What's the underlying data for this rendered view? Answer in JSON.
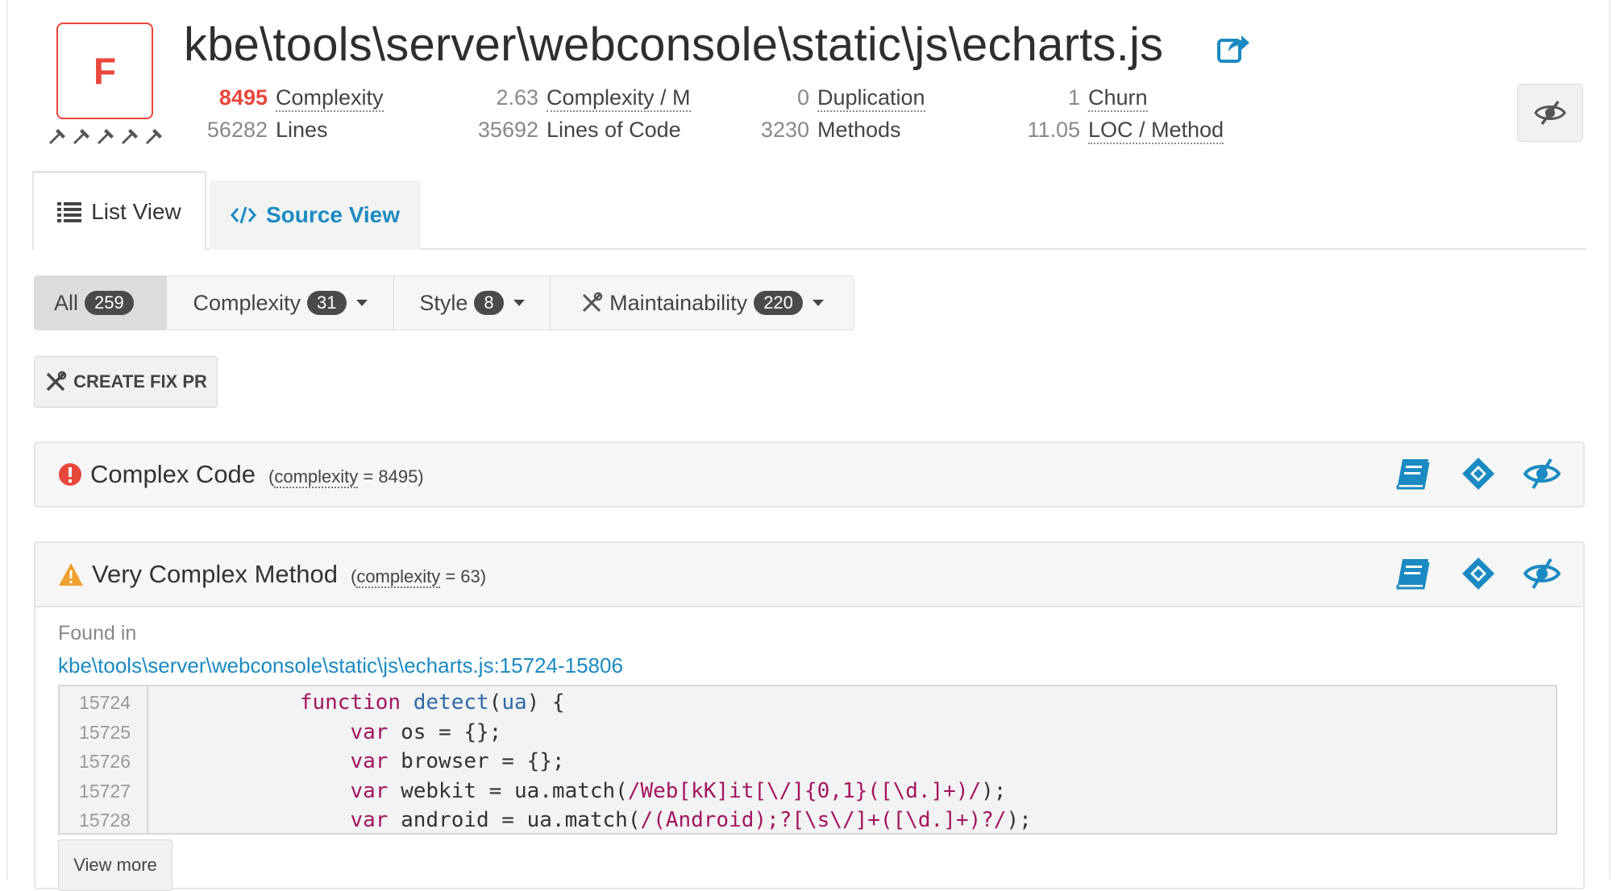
{
  "file": {
    "grade": "F",
    "title": "kbe\\tools\\server\\webconsole\\static\\js\\echarts.js",
    "share_icon": "external-share-icon"
  },
  "metrics": {
    "complexity": {
      "value": "8495",
      "label": "Complexity"
    },
    "lines": {
      "value": "56282",
      "label": "Lines"
    },
    "complexity_per_m": {
      "value": "2.63",
      "label": "Complexity / M"
    },
    "lines_of_code": {
      "value": "35692",
      "label": "Lines of Code"
    },
    "duplication": {
      "value": "0",
      "label": "Duplication"
    },
    "methods": {
      "value": "3230",
      "label": "Methods"
    },
    "churn": {
      "value": "1",
      "label": "Churn"
    },
    "loc_per_method": {
      "value": "11.05",
      "label": "LOC / Method"
    }
  },
  "tabs": [
    {
      "label": "List View",
      "icon": "list-icon",
      "active": true
    },
    {
      "label": "Source View",
      "icon": "code-icon",
      "active": false
    }
  ],
  "filters": [
    {
      "label": "All",
      "count": "259",
      "active": true
    },
    {
      "label": "Complexity",
      "count": "31"
    },
    {
      "label": "Style",
      "count": "8"
    },
    {
      "label": "Maintainability",
      "count": "220",
      "icon": "tools-icon"
    }
  ],
  "fix_button": {
    "label": "CREATE FIX PR"
  },
  "issues": [
    {
      "title": "Complex Code",
      "meta_prefix": "(",
      "meta_key": "complexity",
      "meta_suffix": " = 8495)",
      "severity": "error"
    },
    {
      "title": "Very Complex Method",
      "meta_prefix": "(",
      "meta_key": "complexity",
      "meta_suffix": " = 63)",
      "severity": "warning",
      "found_in_label": "Found in",
      "location": "kbe\\tools\\server\\webconsole\\static\\js\\echarts.js:15724-15806",
      "line_numbers": [
        "15724",
        "15725",
        "15726",
        "15727",
        "15728"
      ],
      "view_more": "View more"
    }
  ],
  "colors": {
    "grade_red": "#e8473b",
    "link_blue": "#1b8ac2",
    "warning_orange": "#f0a030",
    "keyword": "#a3155f"
  }
}
